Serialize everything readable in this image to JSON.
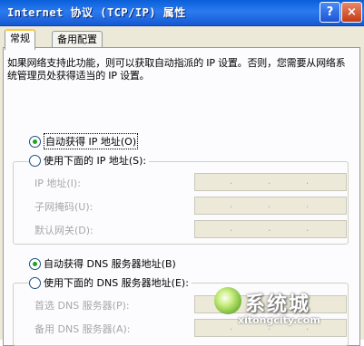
{
  "window": {
    "title": "Internet 协议 (TCP/IP) 属性",
    "help_glyph": "?",
    "close_glyph": "×"
  },
  "tabs": [
    {
      "label": "常规",
      "active": true
    },
    {
      "label": "备用配置",
      "active": false
    }
  ],
  "description": "如果网络支持此功能，则可以获取自动指派的 IP 设置。否则，您需要从网络系统管理员处获得适当的 IP 设置。",
  "ip": {
    "auto_option": "自动获得 IP 地址(O)",
    "manual_option": "使用下面的 IP 地址(S):",
    "selected": "auto",
    "fields": [
      {
        "label": "IP 地址(I):",
        "value": ". . ."
      },
      {
        "label": "子网掩码(U):",
        "value": ". . ."
      },
      {
        "label": "默认网关(D):",
        "value": ". . ."
      }
    ]
  },
  "dns": {
    "auto_option": "自动获得 DNS 服务器地址(B)",
    "manual_option": "使用下面的 DNS 服务器地址(E):",
    "selected": "auto",
    "fields": [
      {
        "label": "首选 DNS 服务器(P):",
        "value": ". . ."
      },
      {
        "label": "备用 DNS 服务器(A):",
        "value": ". . ."
      }
    ]
  },
  "watermark": {
    "brand": "系统城",
    "url": "xitongcity.com"
  },
  "colors": {
    "titlebar": "#0a5fd8",
    "dialog_bg": "#ece9d8",
    "radio_dot": "#21a121",
    "disabled_text": "#a7a6aa"
  }
}
